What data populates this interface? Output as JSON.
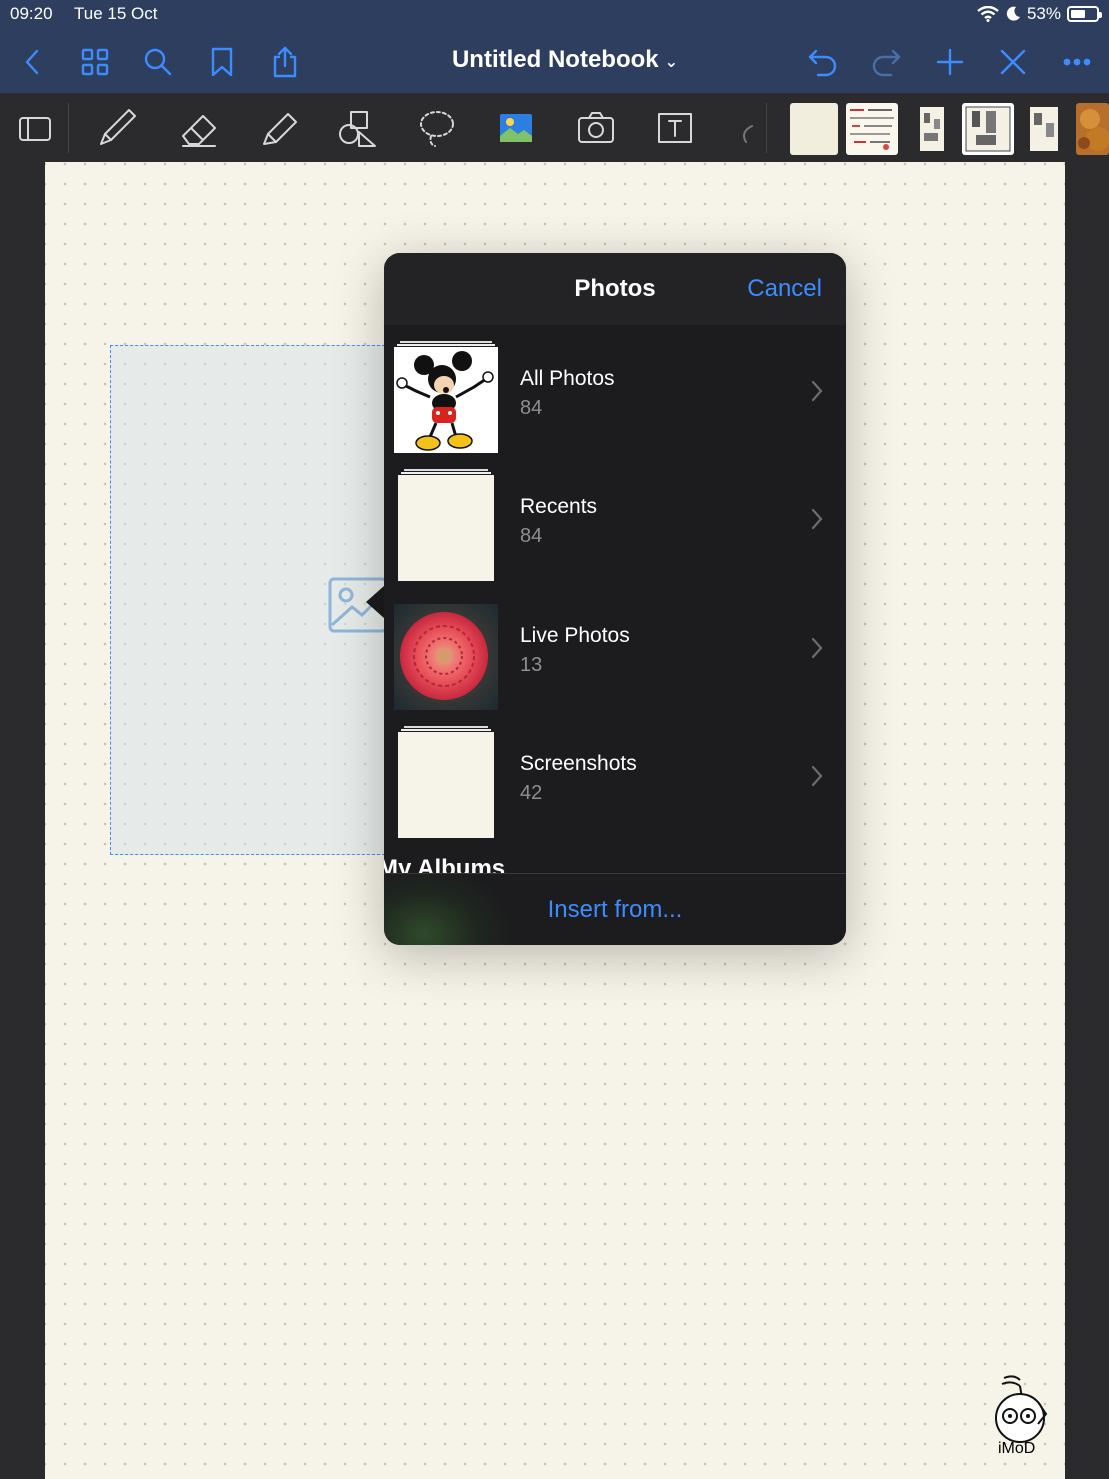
{
  "status_bar": {
    "time": "09:20",
    "date": "Tue 15 Oct",
    "battery": "53%"
  },
  "nav": {
    "title": "Untitled Notebook"
  },
  "popover": {
    "title": "Photos",
    "cancel_label": "Cancel",
    "albums": [
      {
        "name": "All Photos",
        "count": "84"
      },
      {
        "name": "Recents",
        "count": "84"
      },
      {
        "name": "Live Photos",
        "count": "13"
      },
      {
        "name": "Screenshots",
        "count": "42"
      }
    ],
    "section_header": "My Albums",
    "insert_label": "Insert from..."
  },
  "watermark": {
    "text": "iMoD"
  },
  "colors": {
    "accent": "#3d8cff",
    "navbar": "#2e3e5e",
    "popover_bg": "#1c1c1e",
    "paper": "#f6f3e8"
  }
}
